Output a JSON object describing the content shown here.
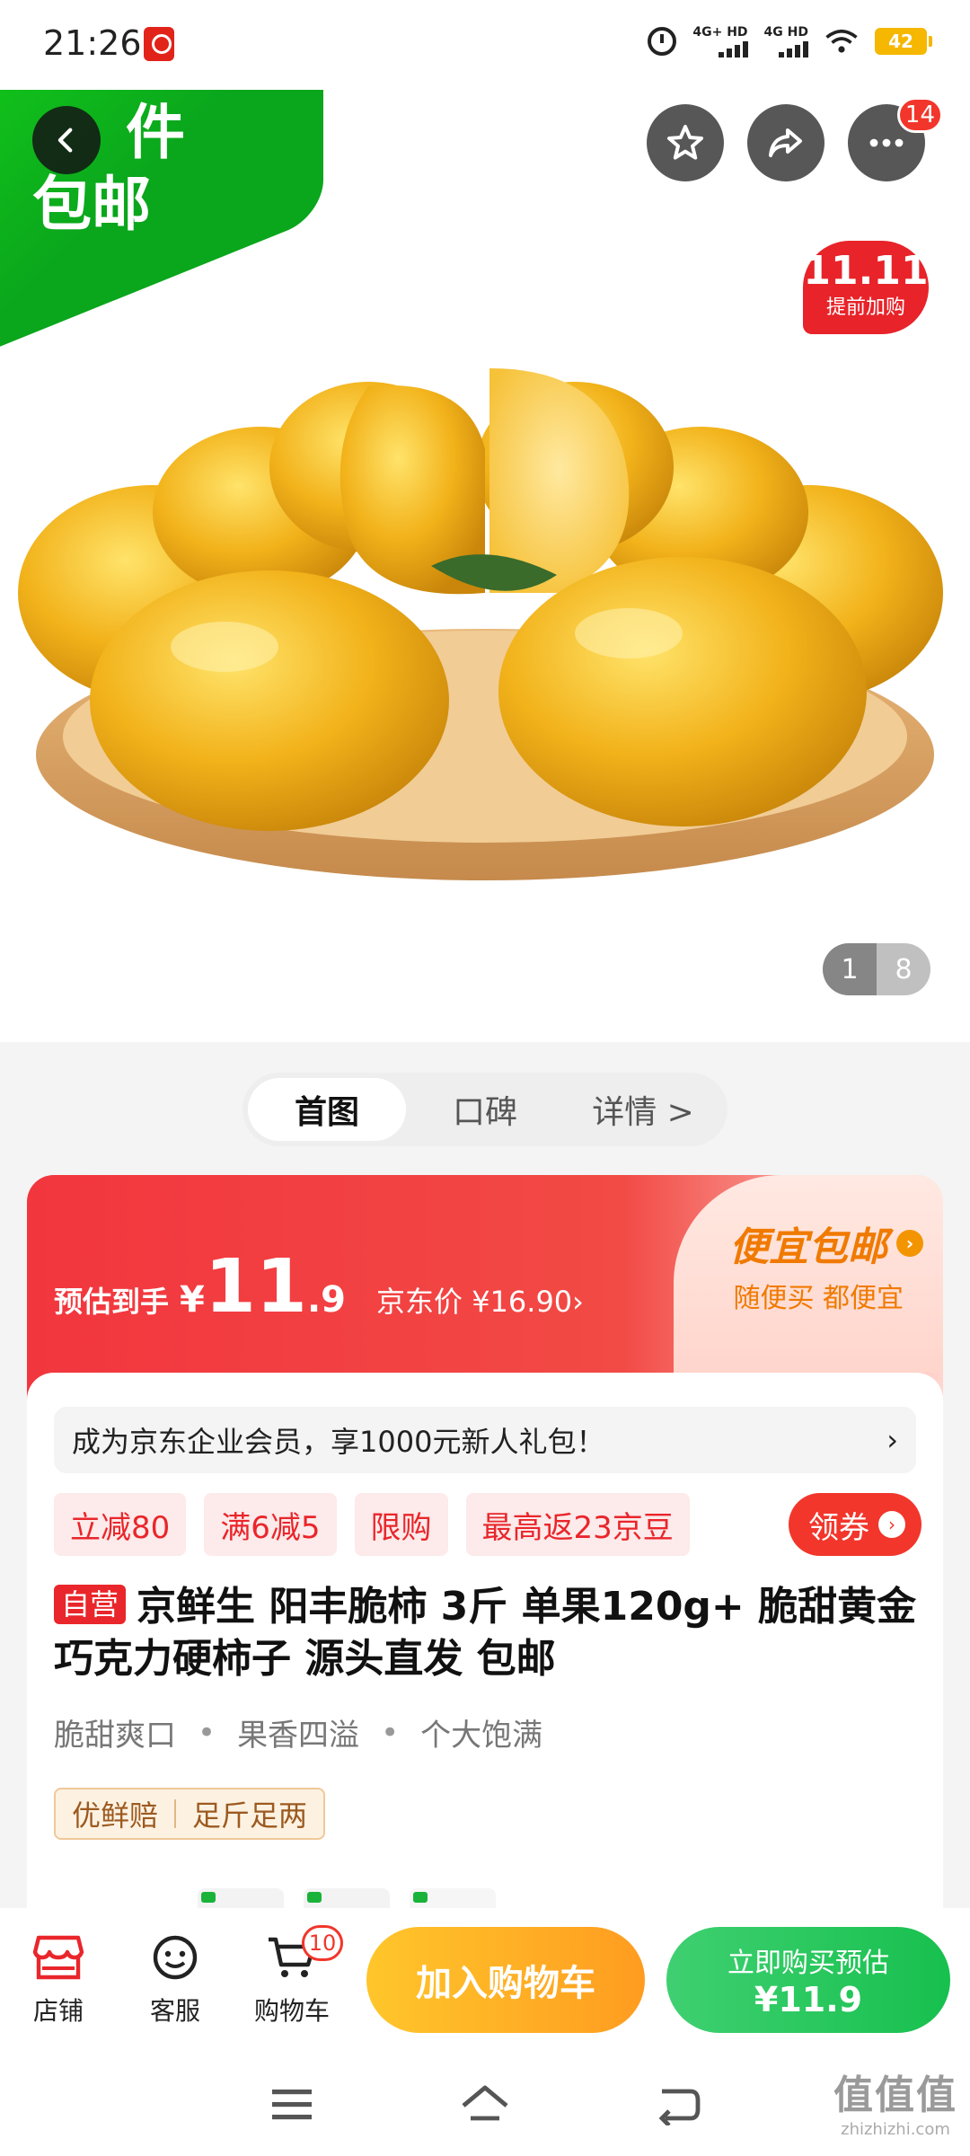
{
  "status_bar": {
    "time": "21:26",
    "signal1_label": "4G+ HD",
    "signal2_label": "4G HD",
    "battery": "42"
  },
  "hero": {
    "ribbon_text_line1": "件",
    "ribbon_text_line2": "包邮",
    "message_badge": "14",
    "promo_big": "11.11",
    "promo_small": "提前加购",
    "image_index": "1",
    "image_total": "8"
  },
  "tabs": [
    {
      "label": "首图"
    },
    {
      "label": "口碑"
    },
    {
      "label": "详情 >"
    }
  ],
  "price": {
    "est_label": "预估到手",
    "currency": "¥",
    "integer": "11",
    "decimal": ".9",
    "jd_price": "京东价 ¥16.90›",
    "cheap_title": "便宜包邮",
    "cheap_sub": "随便买 都便宜"
  },
  "member_banner": {
    "text": "成为京东企业会员，享1000元新人礼包！",
    "chevron": "›"
  },
  "coupons": [
    "立减80",
    "满6减5",
    "限购",
    "最高返23京豆"
  ],
  "get_coupon_label": "领券",
  "product": {
    "self_badge": "自营",
    "title": "京鲜生 阳丰脆柿 3斤 单果120g+ 脆甜黄金巧克力硬柿子 源头直发 包邮",
    "features": [
      "脆甜爽口",
      "果香四溢",
      "个大饱满"
    ],
    "feature_sep": "•",
    "guarantees": [
      "优鲜赔",
      "足斤足两"
    ]
  },
  "bottom_bar": {
    "store_label": "店铺",
    "service_label": "客服",
    "cart_label": "购物车",
    "cart_count": "10",
    "add_cart_label": "加入购物车",
    "buy_now_line1": "立即购买预估",
    "buy_now_line2": "¥11.9"
  },
  "watermark": {
    "mark": "值值值",
    "url": "zhizhizhi.com"
  },
  "colors": {
    "jd_red": "#f2362b",
    "ribbon_green": "#0aa61c",
    "cart_yellow": "#ffb020",
    "buy_green": "#17c04e",
    "persimmon": "#f2b21a"
  }
}
